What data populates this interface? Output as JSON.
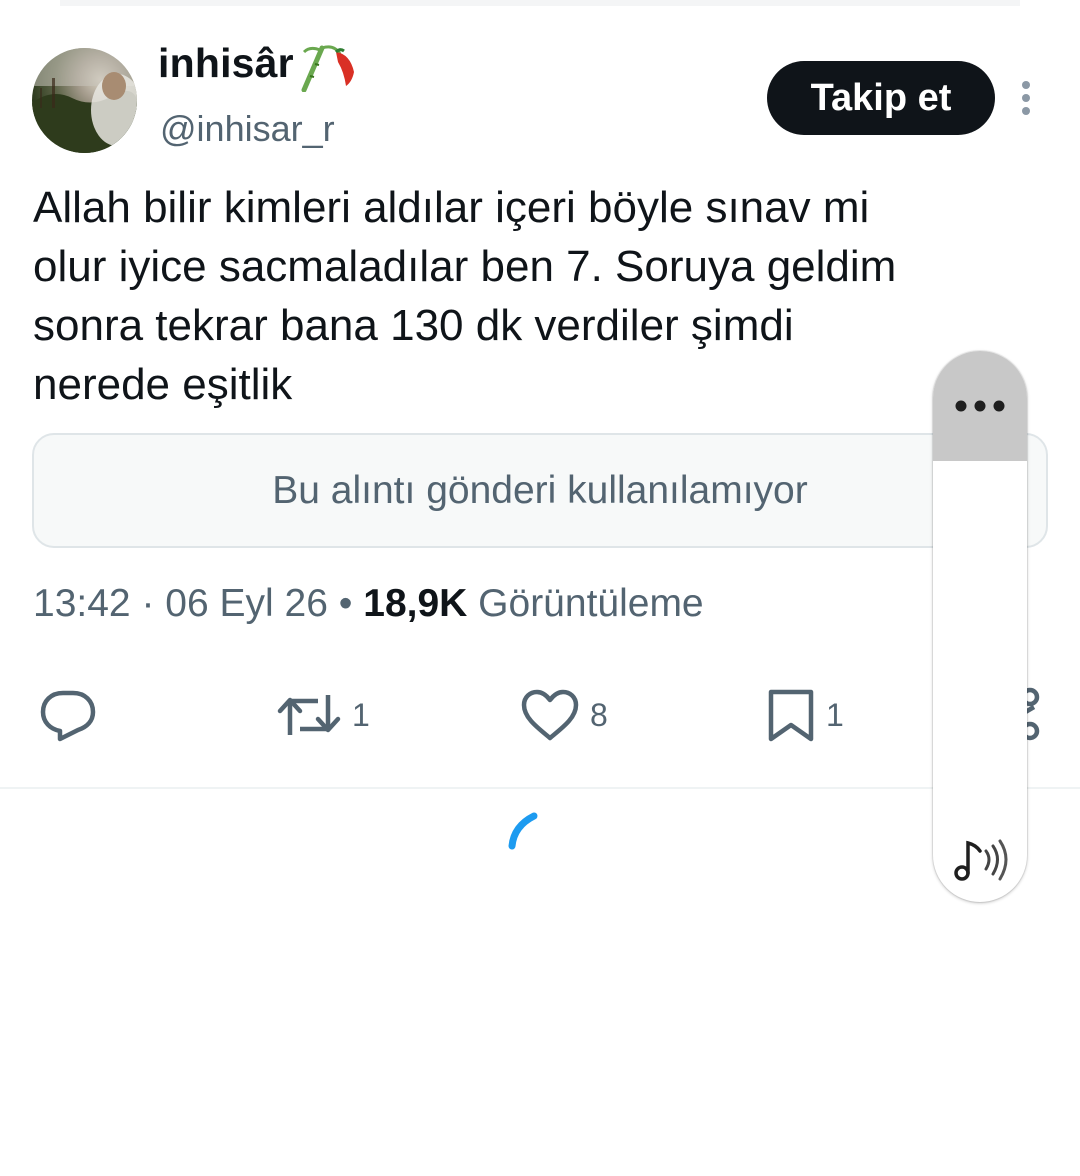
{
  "user": {
    "display_name": "inhisâr",
    "handle": "@inhisar_r",
    "follow_label": "Takip et"
  },
  "tweet": {
    "text": "Allah bilir kimleri aldılar içeri böyle sınav mi\nolur iyice sacmaladılar ben 7. Soruya geldim\nsonra tekrar bana 130 dk verdiler şimdi\nnerede eşitlik",
    "quote_unavailable": "Bu alıntı gönderi kullanılamıyor",
    "time": "13:42",
    "date": "06 Eyl 26",
    "separator": "·",
    "bullet": "•",
    "views_count": "18,9K",
    "views_label": "Görüntüleme"
  },
  "actions": {
    "reply": {
      "count": ""
    },
    "retweet": {
      "count": "1"
    },
    "like": {
      "count": "8"
    },
    "bookmark": {
      "count": "1"
    }
  },
  "colors": {
    "text_primary": "#0f1419",
    "text_secondary": "#536471",
    "accent": "#1d9bf0",
    "border": "#dfe5e8"
  },
  "icons": [
    "more-vertical-icon",
    "reply-icon",
    "retweet-icon",
    "like-icon",
    "bookmark-icon",
    "share-icon",
    "loading-spinner-icon",
    "ellipsis-icon",
    "audio-icon"
  ]
}
